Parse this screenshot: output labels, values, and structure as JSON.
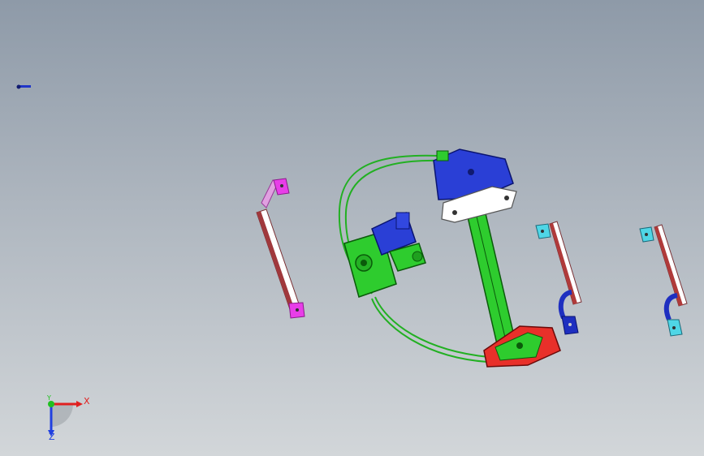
{
  "viewport": {
    "title": "",
    "background_top": "#8e9aa8",
    "background_bottom": "#d2d6d9"
  },
  "triad": {
    "x_label": "X",
    "y_label": "Y",
    "z_label": "Z",
    "x_color": "#e02020",
    "y_color": "#20c020",
    "z_color": "#2040e0"
  },
  "parts": [
    {
      "name": "window-regulator-assembly",
      "colors": [
        "#2ecc2e",
        "#2a3fd6",
        "#ffffff",
        "#e8302a"
      ]
    },
    {
      "name": "left-guide-rail",
      "colors": [
        "#e83ee8",
        "#a0383c"
      ]
    },
    {
      "name": "middle-guide-rail",
      "colors": [
        "#4fd6e6",
        "#1e2fc0",
        "#b03a3a"
      ]
    },
    {
      "name": "right-guide-rail",
      "colors": [
        "#4fd6e6",
        "#1e2fc0",
        "#b03a3a"
      ]
    },
    {
      "name": "small-fastener",
      "colors": [
        "#2035c8"
      ]
    }
  ]
}
